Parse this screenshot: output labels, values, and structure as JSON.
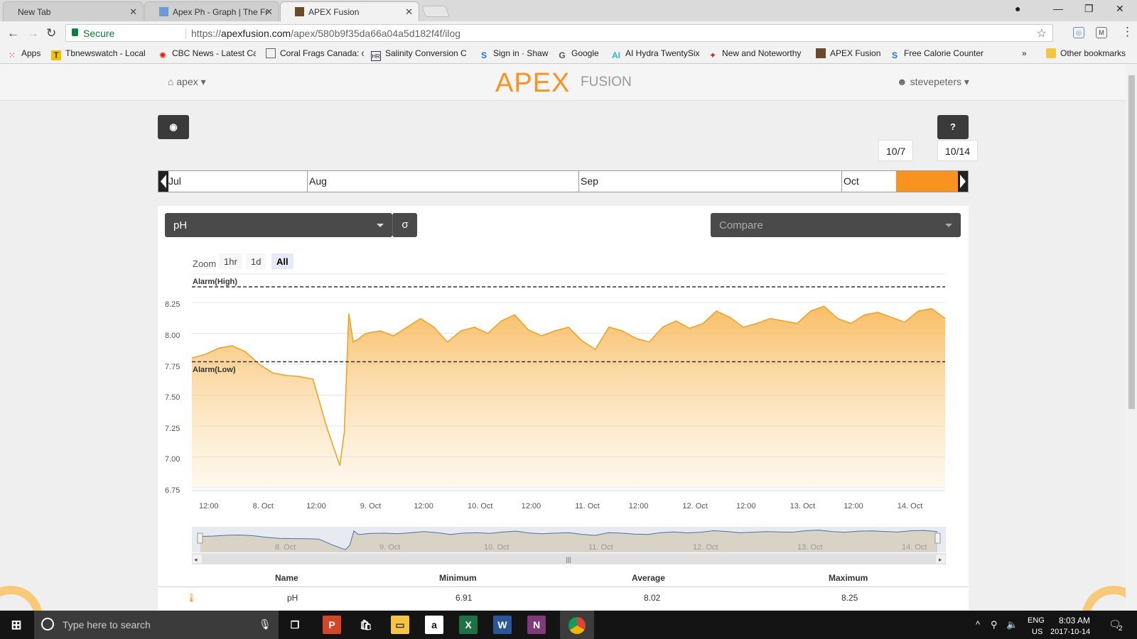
{
  "browser": {
    "tabs": [
      {
        "title": "New Tab"
      },
      {
        "title": "Apex Ph - Graph | The Fr"
      },
      {
        "title": "APEX Fusion"
      }
    ],
    "address": {
      "secure_label": "Secure",
      "url_scheme": "https://",
      "url_host": "apexfusion.com",
      "url_path": "/apex/580b9f35da66a04a5d182f4f/ilog"
    },
    "bookmarks": [
      {
        "label": "Apps",
        "icon": "apps-grid-icon"
      },
      {
        "label": "Tbnewswatch - Local",
        "icon": "tbnewswatch-icon"
      },
      {
        "label": "CBC News - Latest Ca",
        "icon": "cbc-icon"
      },
      {
        "label": "Coral Frags Canada: c",
        "icon": "page-icon"
      },
      {
        "label": "Salinity Conversion C",
        "icon": "salinity-icon"
      },
      {
        "label": "Sign in · Shaw",
        "icon": "shaw-icon"
      },
      {
        "label": "Google",
        "icon": "google-icon"
      },
      {
        "label": "AI Hydra TwentySix",
        "icon": "ai-icon"
      },
      {
        "label": "New and Noteworthy",
        "icon": "noteworthy-icon"
      },
      {
        "label": "APEX Fusion",
        "icon": "apex-icon"
      },
      {
        "label": "Free Calorie Counter",
        "icon": "calorie-icon"
      }
    ],
    "overflow": "»",
    "other_bookmarks": "Other bookmarks"
  },
  "app": {
    "nav_home": "apex",
    "logo_apex": "APEX",
    "logo_fusion": "FUSION",
    "user": "stevepeters",
    "help_label": "?",
    "range_start": "10/7",
    "range_end": "10/14",
    "months": [
      "Jul",
      "Aug",
      "Sep",
      "Oct"
    ],
    "probe_select": "pH",
    "sigma_label": "σ",
    "compare_placeholder": "Compare",
    "zoom_label": "Zoom",
    "zoom_options": [
      "1hr",
      "1d",
      "All"
    ],
    "zoom_selected": "All",
    "alarm_high": "Alarm(High)",
    "alarm_low": "Alarm(Low)",
    "stats": {
      "headers": [
        "Name",
        "Minimum",
        "Average",
        "Maximum"
      ],
      "row": [
        "pH",
        "6.91",
        "8.02",
        "8.25"
      ]
    }
  },
  "chart_data": {
    "type": "area",
    "title": "",
    "ylabel": "",
    "ylim": [
      6.75,
      8.25
    ],
    "yticks": [
      "8.25",
      "8.00",
      "7.75",
      "7.50",
      "7.25",
      "7.00",
      "6.75"
    ],
    "xticks": [
      "12:00",
      "8. Oct",
      "12:00",
      "9. Oct",
      "12:00",
      "10. Oct",
      "12:00",
      "11. Oct",
      "12:00",
      "12. Oct",
      "12:00",
      "13. Oct",
      "12:00",
      "14. Oct"
    ],
    "navigator_ticks": [
      "8. Oct",
      "9. Oct",
      "10. Oct",
      "11. Oct",
      "12. Oct",
      "13. Oct",
      "14. Oct"
    ],
    "alarm_high": 8.37,
    "alarm_low": 7.77,
    "series": [
      {
        "x_hours": [
          0,
          3,
          6,
          9,
          12,
          15,
          18,
          21,
          24,
          27,
          30,
          33,
          34,
          35,
          36,
          37,
          38,
          39,
          42,
          45,
          48,
          51,
          54,
          57,
          60,
          63,
          66,
          69,
          72,
          75,
          78,
          81,
          84,
          87,
          90,
          93,
          96,
          99,
          102,
          105,
          108,
          111,
          114,
          117,
          120,
          123,
          126,
          129,
          132,
          135,
          138,
          141,
          144,
          147,
          150,
          153,
          156,
          159,
          162,
          165,
          168
        ],
        "values": [
          7.8,
          7.83,
          7.88,
          7.9,
          7.85,
          7.75,
          7.68,
          7.66,
          7.65,
          7.63,
          7.25,
          6.93,
          7.2,
          8.16,
          7.93,
          7.95,
          7.98,
          8.0,
          8.02,
          7.98,
          8.05,
          8.12,
          8.05,
          7.93,
          8.02,
          8.05,
          8.0,
          8.1,
          8.15,
          8.03,
          7.98,
          8.02,
          8.05,
          7.94,
          7.87,
          8.05,
          8.02,
          7.96,
          7.93,
          8.05,
          8.1,
          8.04,
          8.08,
          8.18,
          8.13,
          8.05,
          8.08,
          8.12,
          8.1,
          8.08,
          8.18,
          8.22,
          8.12,
          8.08,
          8.15,
          8.17,
          8.13,
          8.09,
          8.18,
          8.2,
          8.12
        ]
      }
    ]
  },
  "taskbar": {
    "search_placeholder": "Type here to search",
    "lang": "ENG",
    "region": "US",
    "time": "8:03 AM",
    "date": "2017-10-14",
    "notifications": "2"
  }
}
